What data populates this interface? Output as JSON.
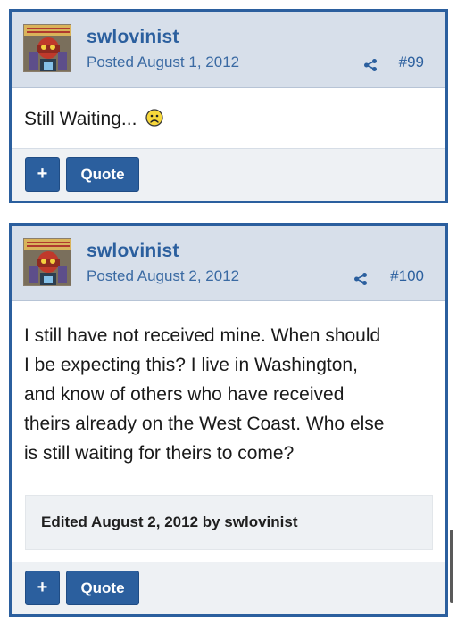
{
  "posts": [
    {
      "username": "swlovinist",
      "posted_prefix": "Posted",
      "date": "August 1, 2012",
      "number": "#99",
      "body": "Still Waiting...",
      "emoji": "frown-emoji",
      "actions": {
        "plus_label": "+",
        "quote_label": "Quote"
      }
    },
    {
      "username": "swlovinist",
      "posted_prefix": "Posted",
      "date": "August 2, 2012",
      "number": "#100",
      "body_lines": [
        "I still have not received mine. When should",
        "I be expecting this? I live in Washington,",
        "and know of others who have received",
        "theirs already on the West Coast. Who else",
        "is still waiting for theirs to come?"
      ],
      "edited": "Edited August 2, 2012 by swlovinist",
      "actions": {
        "plus_label": "+",
        "quote_label": "Quote"
      }
    }
  ],
  "colors": {
    "accent": "#2b5f9e",
    "header_bg": "#d7dfea",
    "footer_bg": "#eef1f4"
  },
  "icons": {
    "share": "share-icon",
    "avatar": "avatar"
  }
}
